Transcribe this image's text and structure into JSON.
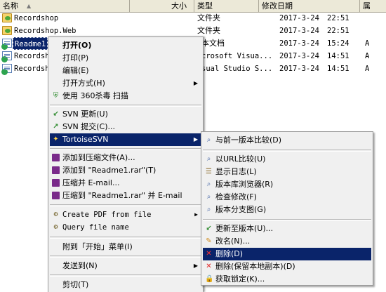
{
  "header": {
    "col_name": "名称",
    "col_size": "大小",
    "col_type": "类型",
    "col_modified": "修改日期",
    "col_attr": "属"
  },
  "files": [
    {
      "name": "Recordshop",
      "type": "文件夹",
      "date": "2017-3-24",
      "time": "22:51",
      "attr": "",
      "icon": "folder-icon"
    },
    {
      "name": "Recordshop.Web",
      "type": "文件夹",
      "date": "2017-3-24",
      "time": "22:51",
      "attr": "",
      "icon": "folder-icon"
    },
    {
      "name": "Readme1.",
      "type": "本文档",
      "date": "2017-3-24",
      "time": "15:24",
      "attr": "A",
      "icon": "document-icon"
    },
    {
      "name": "Recordsh",
      "type": "crosoft Visua...",
      "date": "2017-3-24",
      "time": "14:51",
      "attr": "A",
      "icon": "document-icon"
    },
    {
      "name": "Recordsh",
      "type": "sual Studio S...",
      "date": "2017-3-24",
      "time": "14:51",
      "attr": "A",
      "icon": "document-icon"
    }
  ],
  "context_menu": {
    "open": "打开(O)",
    "print": "打印(P)",
    "edit": "编辑(E)",
    "open_with": "打开方式(H)",
    "scan_360": "使用 360杀毒 扫描",
    "svn_update": "SVN 更新(U)",
    "svn_commit": "SVN 提交(C)...",
    "tortoise": "TortoiseSVN",
    "add_archive": "添加到压缩文件(A)...",
    "add_rar": "添加到 \"Readme1.rar\"(T)",
    "compress_email": "压缩并 E-mail...",
    "compress_rar_email": "压缩到 \"Readme1.rar\" 并 E-mail",
    "create_pdf": "Create PDF from file",
    "query_file": "Query file name",
    "attach_start": "附到「开始」菜单(I)",
    "send_to": "发送到(N)",
    "cut": "剪切(T)"
  },
  "submenu": {
    "diff_prev": "与前一版本比较(D)",
    "diff_url": "以URL比较(U)",
    "show_log": "显示日志(L)",
    "repo_browser": "版本库浏览器(R)",
    "check_mod": "检查修改(F)",
    "rev_graph": "版本分支图(G)",
    "update_rev": "更新至版本(U)...",
    "rename": "改名(N)...",
    "delete": "删除(D)",
    "delete_keep": "删除(保留本地副本)(D)",
    "get_lock": "获取锁定(K)..."
  },
  "colors": {
    "highlight": "#0a246a",
    "menu_bg": "#f0f0f0",
    "header_bg": "#ece9d8"
  }
}
